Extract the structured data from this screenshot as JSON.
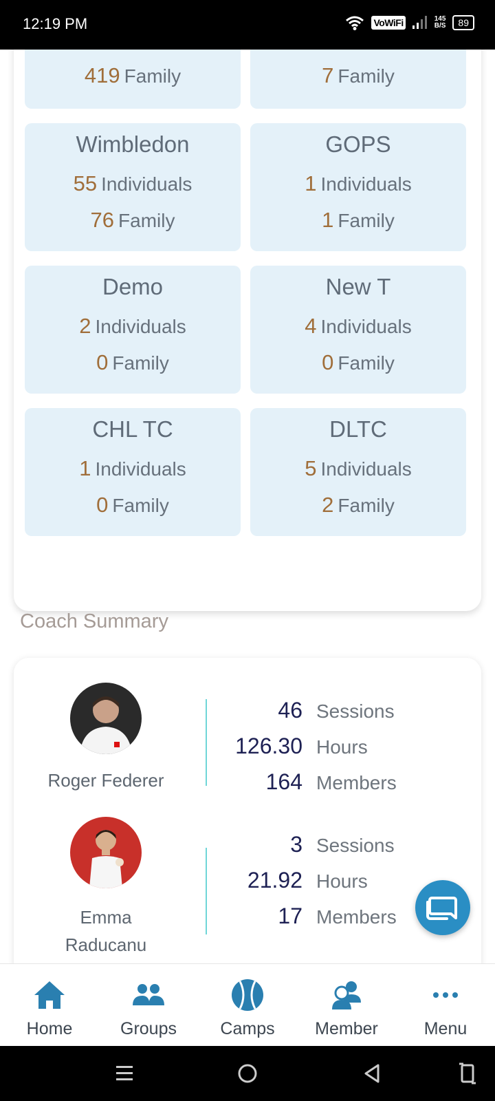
{
  "status_bar": {
    "time": "12:19 PM",
    "vowifi": "VoWiFi",
    "net_speed_value": "145",
    "net_speed_unit": "B/S",
    "battery": "89"
  },
  "groups": [
    {
      "name": "",
      "individuals_count": "",
      "individuals_label": "",
      "family_count": "419",
      "family_label": "Family"
    },
    {
      "name": "",
      "individuals_count": "",
      "individuals_label": "",
      "family_count": "7",
      "family_label": "Family"
    },
    {
      "name": "Wimbledon",
      "individuals_count": "55",
      "individuals_label": "Individuals",
      "family_count": "76",
      "family_label": "Family"
    },
    {
      "name": "GOPS",
      "individuals_count": "1",
      "individuals_label": "Individuals",
      "family_count": "1",
      "family_label": "Family"
    },
    {
      "name": "Demo",
      "individuals_count": "2",
      "individuals_label": "Individuals",
      "family_count": "0",
      "family_label": "Family"
    },
    {
      "name": "New T",
      "individuals_count": "4",
      "individuals_label": "Individuals",
      "family_count": "0",
      "family_label": "Family"
    },
    {
      "name": "CHL TC",
      "individuals_count": "1",
      "individuals_label": "Individuals",
      "family_count": "0",
      "family_label": "Family"
    },
    {
      "name": "DLTC",
      "individuals_count": "5",
      "individuals_label": "Individuals",
      "family_count": "2",
      "family_label": "Family"
    }
  ],
  "coach_summary": {
    "title": "Coach Summary",
    "coaches": [
      {
        "name_line1": "Roger Federer",
        "name_line2": "",
        "sessions": "46",
        "sessions_label": "Sessions",
        "hours": "126.30",
        "hours_label": "Hours",
        "members": "164",
        "members_label": "Members",
        "avatar_color": "#2a2a2a"
      },
      {
        "name_line1": "Emma",
        "name_line2": "Raducanu",
        "sessions": "3",
        "sessions_label": "Sessions",
        "hours": "21.92",
        "hours_label": "Hours",
        "members": "17",
        "members_label": "Members",
        "avatar_color": "#c8302a"
      }
    ]
  },
  "bottom_nav": {
    "items": [
      {
        "label": "Home",
        "icon": "home-icon"
      },
      {
        "label": "Groups",
        "icon": "groups-icon"
      },
      {
        "label": "Camps",
        "icon": "tennis-ball-icon"
      },
      {
        "label": "Member",
        "icon": "member-icon"
      },
      {
        "label": "Menu",
        "icon": "more-icon"
      }
    ],
    "accent": "#2a7fb0"
  },
  "colors": {
    "tile_bg": "#e4f1f9",
    "count": "#a06e3a",
    "stat_value": "#1e2154",
    "divider": "#6fd6d8",
    "fab": "#2a8ec4"
  }
}
